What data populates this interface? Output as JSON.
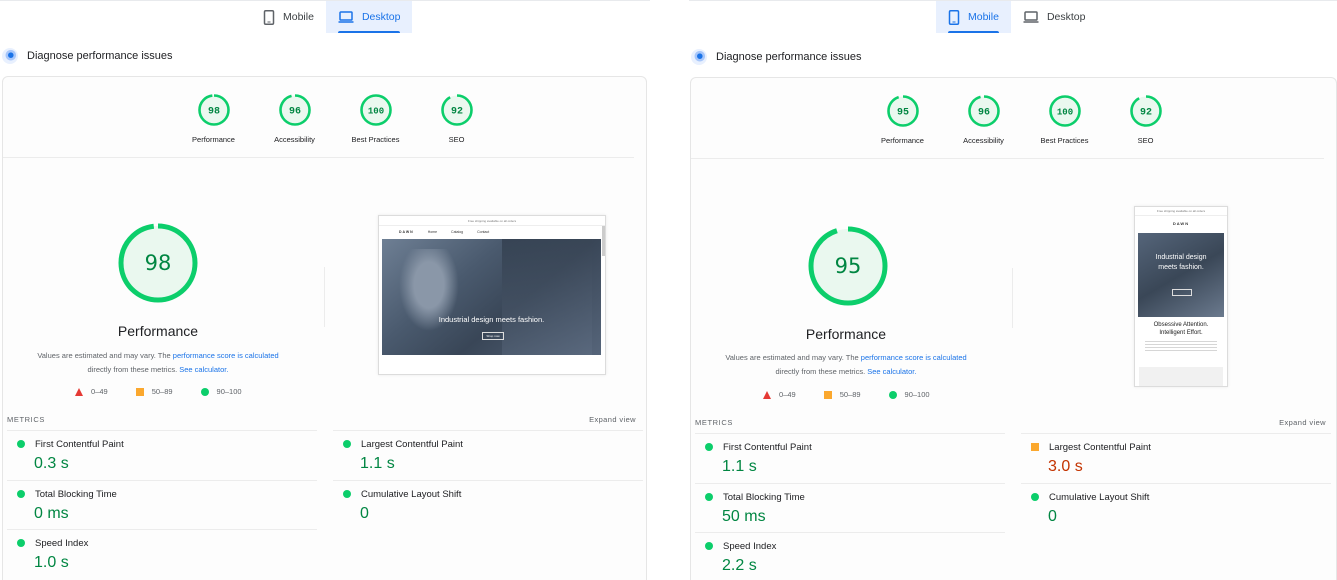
{
  "left": {
    "tabs": [
      {
        "label": "Mobile",
        "active": false,
        "icon": "phone-icon"
      },
      {
        "label": "Desktop",
        "active": true,
        "icon": "laptop-icon"
      }
    ],
    "heading": "Diagnose performance issues",
    "gauges": [
      {
        "label": "Performance",
        "score": "98"
      },
      {
        "label": "Accessibility",
        "score": "96"
      },
      {
        "label": "Best Practices",
        "score": "100"
      },
      {
        "label": "SEO",
        "score": "92"
      }
    ],
    "main_score": "98",
    "main_title": "Performance",
    "note": {
      "part1": "Values are estimated and may vary. The ",
      "link1": "performance score is calculated",
      "part2": "directly from these metrics. ",
      "link2": "See calculator."
    },
    "legend": [
      "0–49",
      "50–89",
      "90–100"
    ],
    "thumbnail": {
      "announcement": "Free shipping available on all orders",
      "brand": "DAWN",
      "nav": [
        "Home",
        "Catalog",
        "Contact"
      ],
      "hero_text": "Industrial design meets fashion.",
      "hero_button": "Shop now"
    },
    "metrics_title": "METRICS",
    "expand": "Expand view",
    "metrics": [
      {
        "name": "First Contentful Paint",
        "value": "0.3 s",
        "status": "good"
      },
      {
        "name": "Largest Contentful Paint",
        "value": "1.1 s",
        "status": "good"
      },
      {
        "name": "Total Blocking Time",
        "value": "0 ms",
        "status": "good"
      },
      {
        "name": "Cumulative Layout Shift",
        "value": "0",
        "status": "good"
      },
      {
        "name": "Speed Index",
        "value": "1.0 s",
        "status": "good"
      }
    ]
  },
  "right": {
    "tabs": [
      {
        "label": "Mobile",
        "active": true,
        "icon": "phone-icon"
      },
      {
        "label": "Desktop",
        "active": false,
        "icon": "laptop-icon"
      }
    ],
    "heading": "Diagnose performance issues",
    "gauges": [
      {
        "label": "Performance",
        "score": "95"
      },
      {
        "label": "Accessibility",
        "score": "96"
      },
      {
        "label": "Best Practices",
        "score": "100"
      },
      {
        "label": "SEO",
        "score": "92"
      }
    ],
    "main_score": "95",
    "main_title": "Performance",
    "note": {
      "part1": "Values are estimated and may vary. The ",
      "link1": "performance score is calculated",
      "part2": "directly from these metrics. ",
      "link2": "See calculator."
    },
    "legend": [
      "0–49",
      "50–89",
      "90–100"
    ],
    "thumbnail": {
      "announcement": "Free shipping available on all orders",
      "brand": "DAWN",
      "hero_line1": "Industrial design",
      "hero_line2": "meets fashion.",
      "sub_line1": "Obsessive Attention.",
      "sub_line2": "Intelligent Effort."
    },
    "metrics_title": "METRICS",
    "expand": "Expand view",
    "metrics": [
      {
        "name": "First Contentful Paint",
        "value": "1.1 s",
        "status": "good"
      },
      {
        "name": "Largest Contentful Paint",
        "value": "3.0 s",
        "status": "average"
      },
      {
        "name": "Total Blocking Time",
        "value": "50 ms",
        "status": "good"
      },
      {
        "name": "Cumulative Layout Shift",
        "value": "0",
        "status": "good"
      },
      {
        "name": "Speed Index",
        "value": "2.2 s",
        "status": "good"
      }
    ]
  },
  "colors": {
    "good": "#0cce6b",
    "good_text": "#018642",
    "average": "#fba82e",
    "average_text": "#c33300",
    "poor": "#e53935",
    "accent": "#1a73e8"
  }
}
